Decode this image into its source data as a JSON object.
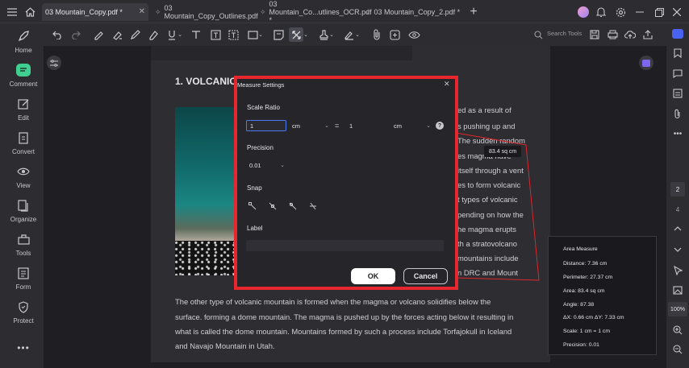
{
  "tabs": [
    {
      "label": "03 Mountain_Copy.pdf *",
      "active": true
    },
    {
      "label": "03 Mountain_Copy_Outlines.pdf",
      "active": false
    },
    {
      "label": "03 Mountain_Co...utlines_OCR.pdf *",
      "active": false
    },
    {
      "label": "03 Mountain_Copy_2.pdf *",
      "active": false
    }
  ],
  "toolbar": {
    "search_label": "Search Tools"
  },
  "sidebar": {
    "items": [
      {
        "label": "Home"
      },
      {
        "label": "Comment"
      },
      {
        "label": "Edit"
      },
      {
        "label": "Convert"
      },
      {
        "label": "View"
      },
      {
        "label": "Organize"
      },
      {
        "label": "Tools"
      },
      {
        "label": "Form"
      },
      {
        "label": "Protect"
      }
    ]
  },
  "rightbar": {
    "page_current": "2",
    "page_total": "4",
    "zoom": "100%"
  },
  "document": {
    "heading": "1. VOLCANIC",
    "right_lines": [
      "ed as a result of",
      "s pushing up and",
      "The sudden random",
      "es  magma  have",
      "itself through a vent",
      "es to form volcanic",
      "t types of volcanic",
      "pending on how the",
      "he magma erupts",
      "th a stratovolcano",
      "mountains include",
      "n DRC and Mount"
    ],
    "bottom_lines": [
      "The other type of volcanic mountain is formed when the magma or volcano solidifies below the",
      "surface. forming a dome mountain. The magma is pushed up by the forces acting below it resulting in",
      "what is called the dome mountain. Mountains formed by such a process include Torfajokull in Iceland",
      "and Navajo Mountain in Utah."
    ],
    "area_callout": "83.4 sq cm"
  },
  "dialog": {
    "title": "Measure Settings",
    "scale_ratio_label": "Scale Ratio",
    "scale_left_value": "1",
    "scale_left_unit": "cm",
    "equals": "=",
    "scale_right_value": "1",
    "scale_right_unit": "cm",
    "precision_label": "Precision",
    "precision_value": "0.01",
    "snap_label": "Snap",
    "label_label": "Label",
    "label_value": "",
    "ok_label": "OK",
    "cancel_label": "Cancel"
  },
  "measure_panel": {
    "title": "Area Measure",
    "rows": [
      "Distance:  7.36 cm",
      "Perimeter:  27.37 cm",
      "Area:  83.4 sq cm",
      "Angle:  87.38",
      "ΔX:  0.66 cm    ΔY:  7.33 cm",
      "Scale:  1 cm = 1 cm",
      "Precision:  0.01"
    ]
  },
  "colors": {
    "accent": "#e8262d",
    "comment_green": "#3fcf8e",
    "app_bg": "#1e1e23"
  }
}
